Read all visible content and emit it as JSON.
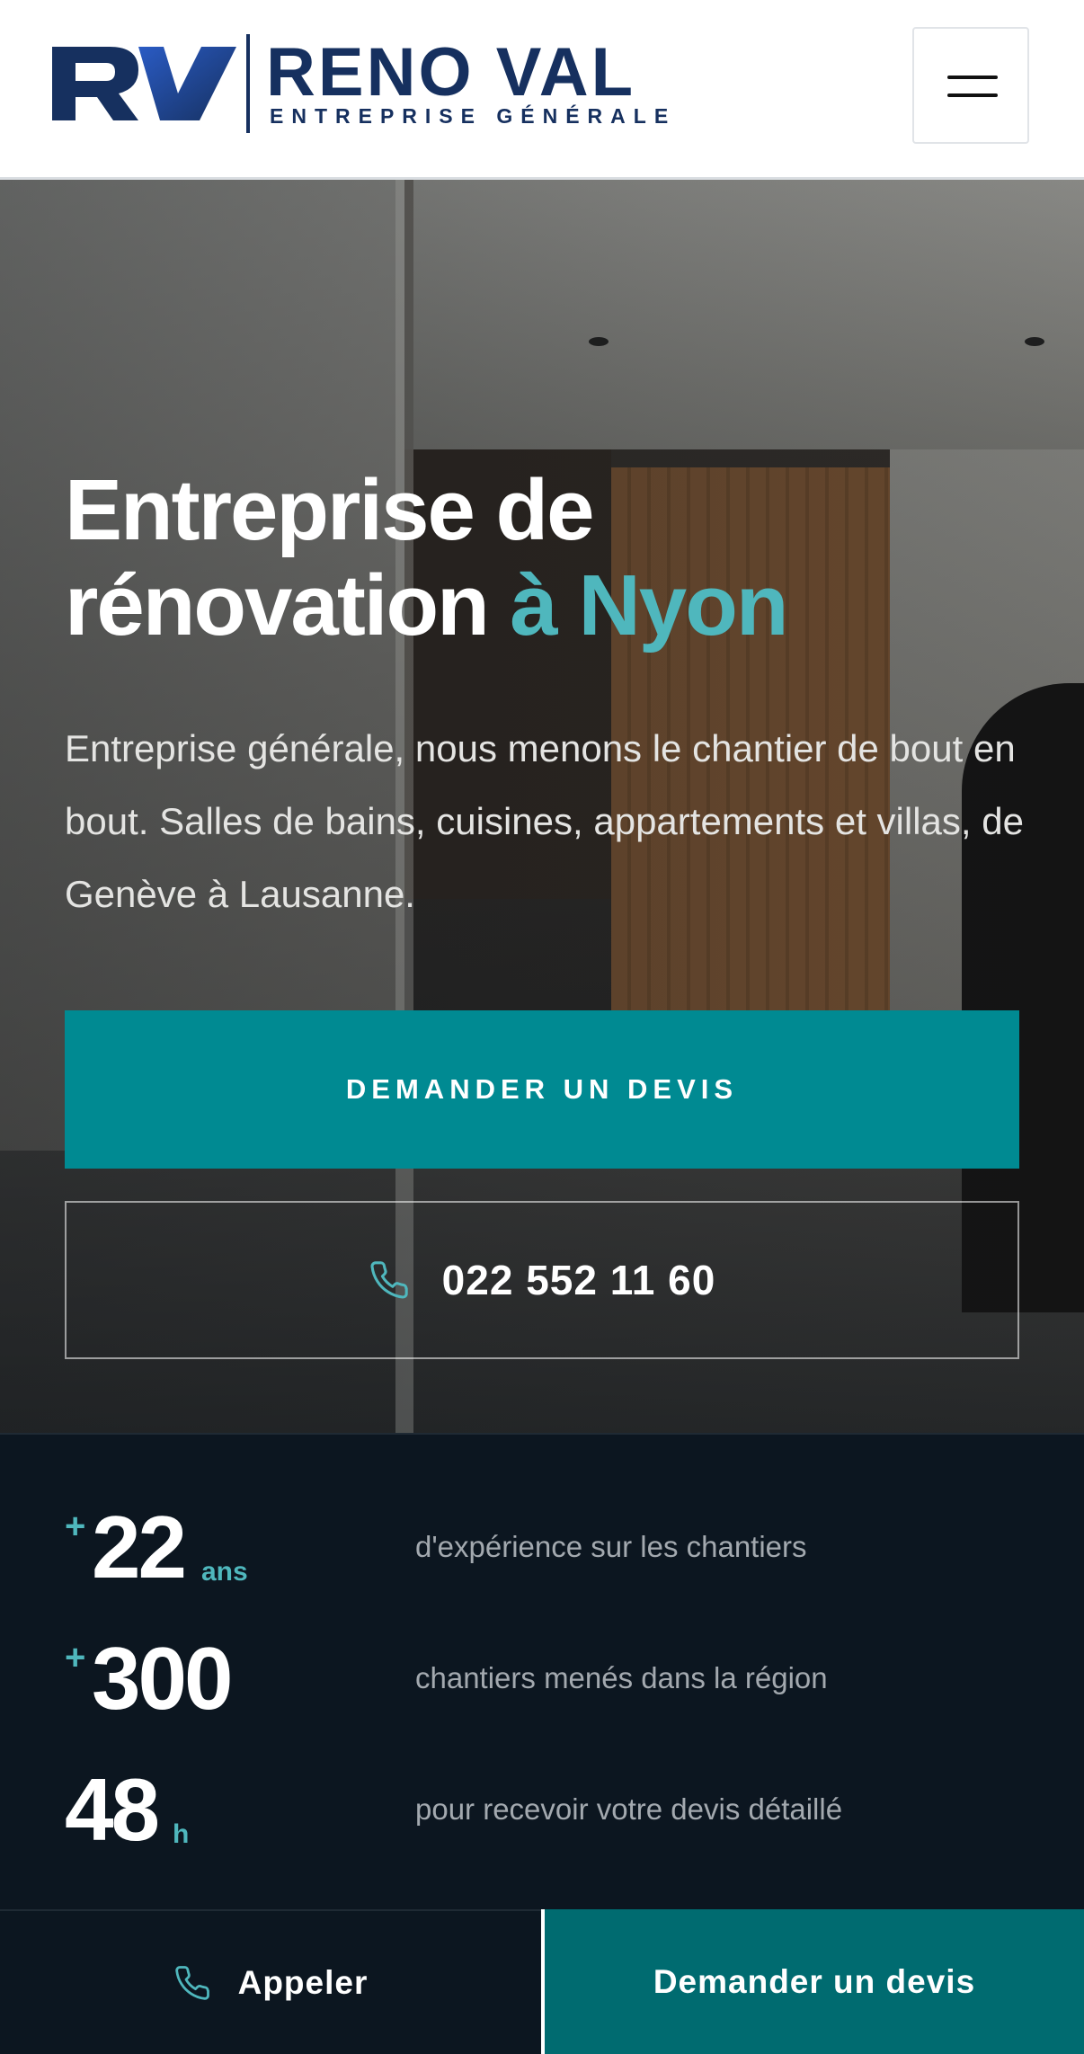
{
  "header": {
    "logo_initials": "RV",
    "logo_name": "RENO VAL",
    "logo_tagline": "ENTREPRISE GÉNÉRALE",
    "menu_icon": "hamburger-menu-icon"
  },
  "hero": {
    "title_line1": "Entreprise de",
    "title_line2": "rénovation",
    "title_accent": "à Nyon",
    "description": "Entreprise générale, nous menons le chantier de bout en bout. Salles de bains, cuisines, appartements et villas, de Genève à Lausanne.",
    "cta_quote": "DEMANDER UN DEVIS",
    "phone_number": "022 552 11 60",
    "phone_icon": "phone-icon"
  },
  "stats": [
    {
      "prefix": "+",
      "value": "22",
      "unit": "ans",
      "description": "d'expérience sur les chantiers"
    },
    {
      "prefix": "+",
      "value": "300",
      "unit": "",
      "description": "chantiers menés dans la région"
    },
    {
      "prefix": "",
      "value": "48",
      "unit": "h",
      "description": "pour recevoir votre devis détaillé"
    }
  ],
  "bottom_bar": {
    "call_label": "Appeler",
    "quote_label": "Demander un devis"
  },
  "colors": {
    "brand_navy": "#16305f",
    "accent_teal": "#4fb7bd",
    "button_teal": "#008a92",
    "bar_teal": "#006b70",
    "dark_bg": "#0c1620"
  }
}
